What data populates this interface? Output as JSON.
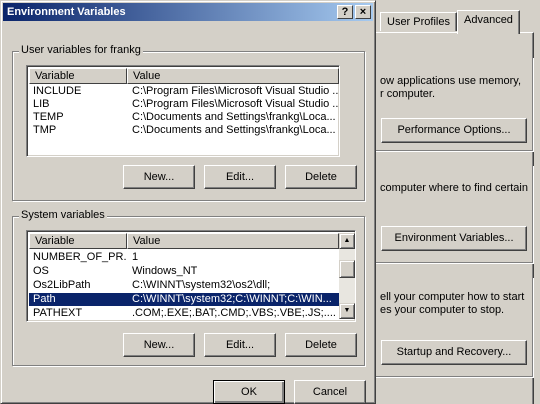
{
  "window": {
    "title": "Environment Variables",
    "help_glyph": "?",
    "close_glyph": "×"
  },
  "user_vars": {
    "group_label": "User variables for frankg",
    "col_variable": "Variable",
    "col_value": "Value",
    "rows": [
      {
        "variable": "INCLUDE",
        "value": "C:\\Program Files\\Microsoft Visual Studio ..."
      },
      {
        "variable": "LIB",
        "value": "C:\\Program Files\\Microsoft Visual Studio ..."
      },
      {
        "variable": "TEMP",
        "value": "C:\\Documents and Settings\\frankg\\Loca..."
      },
      {
        "variable": "TMP",
        "value": "C:\\Documents and Settings\\frankg\\Loca..."
      }
    ],
    "new_label": "New...",
    "edit_label": "Edit...",
    "delete_label": "Delete"
  },
  "system_vars": {
    "group_label": "System variables",
    "col_variable": "Variable",
    "col_value": "Value",
    "rows": [
      {
        "variable": "NUMBER_OF_PR...",
        "value": "1"
      },
      {
        "variable": "OS",
        "value": "Windows_NT"
      },
      {
        "variable": "Os2LibPath",
        "value": "C:\\WINNT\\system32\\os2\\dll;"
      },
      {
        "variable": "Path",
        "value": "C:\\WINNT\\system32;C:\\WINNT;C:\\WIN..."
      },
      {
        "variable": "PATHEXT",
        "value": ".COM;.EXE;.BAT;.CMD;.VBS;.VBE;.JS;...."
      }
    ],
    "selected_row": "Path",
    "new_label": "New...",
    "edit_label": "Edit...",
    "delete_label": "Delete"
  },
  "footer": {
    "ok_label": "OK",
    "cancel_label": "Cancel"
  },
  "background_dialog": {
    "tabs": [
      "User Profiles",
      "Advanced"
    ],
    "active_tab": "Advanced",
    "perf_text_1": "ow applications use memory,",
    "perf_text_2": "r computer.",
    "perf_button": "Performance Options...",
    "env_text": "computer where to find certain",
    "env_button": "Environment Variables...",
    "startup_text_1": "ell your computer how to start",
    "startup_text_2": "es your computer to stop.",
    "startup_button": "Startup and Recovery..."
  },
  "colors": {
    "face": "#d4d0c8",
    "title_start": "#0a246a",
    "title_end": "#a6caf0",
    "selection": "#0a246a"
  }
}
